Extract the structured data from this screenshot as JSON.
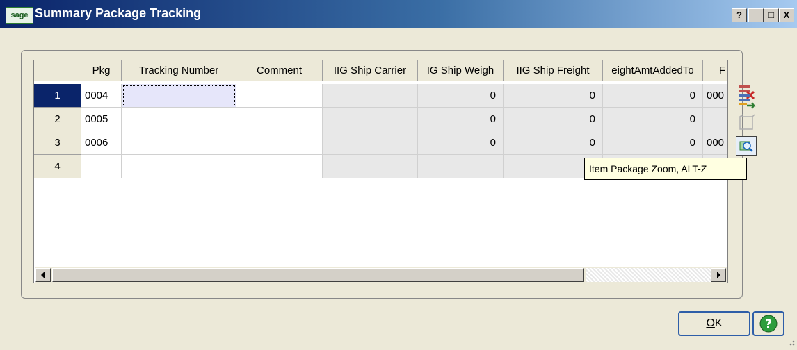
{
  "window": {
    "title": "Summary Package Tracking",
    "logo_text": "sage",
    "help_btn": "?",
    "min_btn": "_",
    "max_btn": "□",
    "close_btn": "X"
  },
  "grid": {
    "columns": [
      "Pkg",
      "Tracking Number",
      "Comment",
      "IIG Ship Carrier",
      "IG Ship Weigh",
      "IIG Ship Freight",
      "eightAmtAddedTo",
      "F"
    ],
    "rows": [
      {
        "num": "1",
        "pkg": "0004",
        "tracking": "",
        "comment": "",
        "carrier": "",
        "weight": "0",
        "freight": "0",
        "added": "0",
        "extra": "000"
      },
      {
        "num": "2",
        "pkg": "0005",
        "tracking": "",
        "comment": "",
        "carrier": "",
        "weight": "0",
        "freight": "0",
        "added": "0",
        "extra": ""
      },
      {
        "num": "3",
        "pkg": "0006",
        "tracking": "",
        "comment": "",
        "carrier": "",
        "weight": "0",
        "freight": "0",
        "added": "0",
        "extra": "000"
      },
      {
        "num": "4",
        "pkg": "",
        "tracking": "",
        "comment": "",
        "carrier": "",
        "weight": "",
        "freight": "",
        "added": "",
        "extra": ""
      }
    ],
    "selected_row": "1"
  },
  "toolbar": {
    "icons": [
      "delete-row-icon",
      "insert-row-icon",
      "blank-icon",
      "item-package-zoom-icon"
    ]
  },
  "tooltip": {
    "text": "Item Package Zoom, ALT-Z"
  },
  "buttons": {
    "ok_prefix": "O",
    "ok_rest": "K"
  },
  "colors": {
    "title_start": "#0a246a",
    "title_end": "#a6caf0",
    "selected_row": "#0a246a",
    "tooltip_bg": "#ffffe1"
  }
}
